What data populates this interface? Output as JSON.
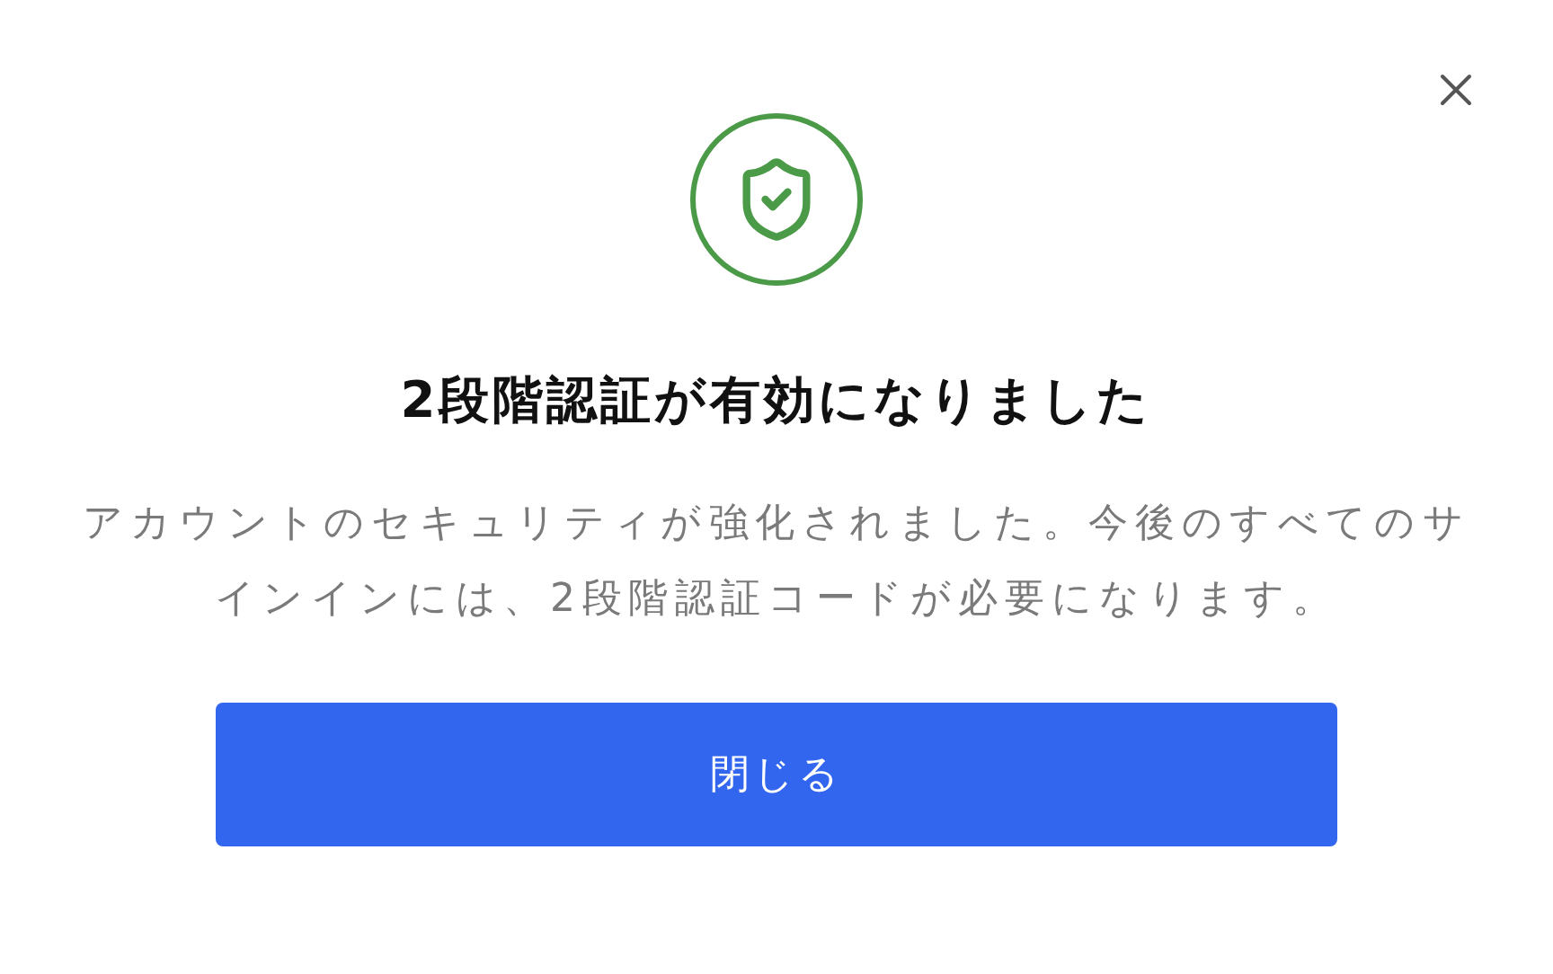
{
  "dialog": {
    "title": "2段階認証が有効になりました",
    "message": "アカウントのセキュリティが強化されました。今後のすべてのサインインには、2段階認証コードが必要になります。",
    "button": "閉じる"
  }
}
